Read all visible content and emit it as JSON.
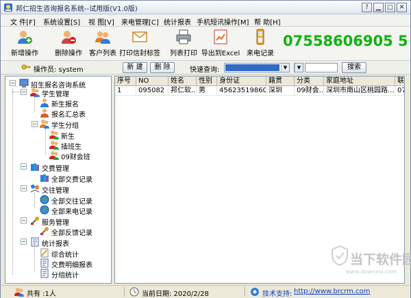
{
  "window": {
    "title": "邦仁招生咨询报名系统--试用版(V1.0版)",
    "buttons": {
      "minimize": "▁",
      "restore": "□",
      "close": "✕",
      "help": "?"
    }
  },
  "menu": [
    "文 件[F]",
    "系统设置[S]",
    "视 图[V]",
    "来电管理[C]",
    "统计报表",
    "手机短讯操作[M]",
    "帮 助[H]"
  ],
  "toolbar": {
    "items": [
      {
        "label": "新增操作",
        "icon": "add-user-icon"
      },
      {
        "label": "删除操作",
        "icon": "delete-user-icon"
      },
      {
        "label": "客户列表",
        "icon": "customer-list-icon"
      },
      {
        "label": "打印信封标签",
        "icon": "envelope-icon"
      },
      {
        "label": "列表打印",
        "icon": "printer-icon"
      },
      {
        "label": "导出到Excel",
        "icon": "excel-export-icon"
      },
      {
        "label": "来电记录",
        "icon": "phone-icon"
      }
    ],
    "phone": "07558606905 5"
  },
  "operator_bar": {
    "operator_label": "操作员: system",
    "new_button": "新 建",
    "delete_button": "删 除",
    "quick_query_label": "快速查询:",
    "search_button": "搜索"
  },
  "tree": {
    "root": "招生报名咨询系统",
    "groups": [
      {
        "label": "学生管理",
        "children": [
          "新生报名",
          "报名汇总表"
        ]
      },
      {
        "label": "学生分组",
        "children": [
          "新生",
          "插班生",
          "09财会班"
        ]
      },
      {
        "label": "交费管理",
        "children": [
          "全部交费记录"
        ]
      },
      {
        "label": "交往管理",
        "children": [
          "全部交往记录",
          "全部来电记录"
        ]
      },
      {
        "label": "服务管理",
        "children": [
          "全部反馈记录"
        ]
      },
      {
        "label": "统计报表",
        "children": [
          "综合统计",
          "交费明细报表",
          "分组统计"
        ]
      }
    ]
  },
  "grid": {
    "columns": [
      "序号",
      "NO",
      "姓名",
      "性别",
      "身份证",
      "籍贯",
      "分类",
      "家庭地址",
      "联"
    ],
    "rows": [
      [
        "1",
        "095082",
        "邦仁软...",
        "男",
        "456235198605...",
        "深圳",
        "09财会...",
        "深圳市南山区桃园路...",
        "07"
      ]
    ]
  },
  "status": {
    "count": "共有 :1人",
    "date": "当前日期:  2020/2/28",
    "support_label": "技术支持:",
    "support_url": "http://www.brcrm.com"
  },
  "watermark": {
    "text": "当下软件园",
    "url": "www.downxia.com"
  },
  "colors": {
    "accent": "#3169c6",
    "phone": "#10b210",
    "link": "#1040c0"
  }
}
